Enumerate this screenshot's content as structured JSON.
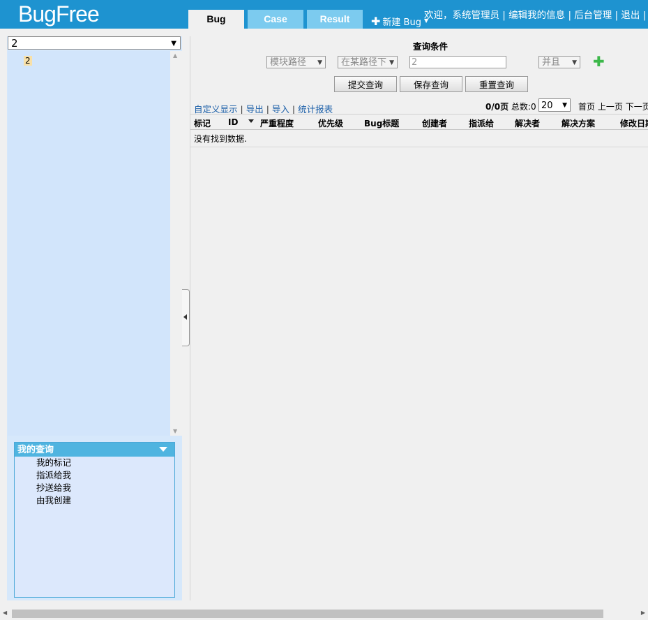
{
  "header": {
    "logo": "BugFree",
    "tabs": [
      {
        "label": "Bug",
        "active": true
      },
      {
        "label": "Case",
        "active": false
      },
      {
        "label": "Result",
        "active": false
      }
    ],
    "new_bug_label": "新建 Bug",
    "user": {
      "welcome": "欢迎，系统管理员",
      "edit_info": "编辑我的信息",
      "admin": "后台管理",
      "logout": "退出"
    }
  },
  "sidebar": {
    "product_selected": "2",
    "tree_node": "2",
    "my_queries": {
      "title": "我的查询",
      "items": [
        "我的标记",
        "指派给我",
        "抄送给我",
        "由我创建"
      ]
    }
  },
  "query": {
    "title": "查询条件",
    "field": "模块路径",
    "operator": "在某路径下",
    "value": "2",
    "andor": "并且",
    "buttons": {
      "submit": "提交查询",
      "save": "保存查询",
      "reset": "重置查询"
    }
  },
  "toolbar": {
    "custom": "自定义显示",
    "export": "导出",
    "import": "导入",
    "report": "统计报表"
  },
  "pager": {
    "pages": "0/0页",
    "total": "总数:0",
    "page_size": "20",
    "first": "首页",
    "prev": "上一页",
    "next": "下一页"
  },
  "grid": {
    "columns": [
      "标记",
      "ID",
      "严重程度",
      "优先级",
      "Bug标题",
      "创建者",
      "指派给",
      "解决者",
      "解决方案",
      "修改日期"
    ],
    "empty_message": "没有找到数据."
  },
  "colors": {
    "header_bg": "#1e93d0",
    "tab_inactive": "#7ccbef",
    "sidebar_bg": "#d6e8fb",
    "query_header": "#4fb4e0",
    "link": "#1a5ea8",
    "add_icon": "#3cb84a"
  }
}
